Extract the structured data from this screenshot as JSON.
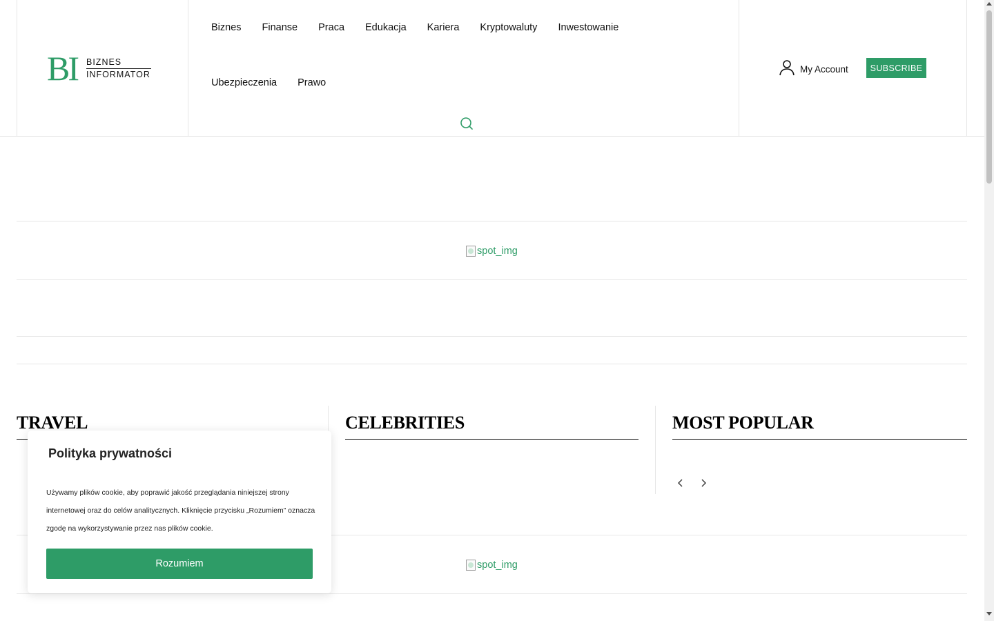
{
  "logo": {
    "mark": "BI",
    "line1": "BIZNES",
    "line2": "INFORMATOR"
  },
  "nav": {
    "row1": [
      "Biznes",
      "Finanse",
      "Praca",
      "Edukacja",
      "Kariera",
      "Kryptowaluty",
      "Inwestowanie"
    ],
    "row2": [
      "Ubezpieczenia",
      "Prawo"
    ],
    "search_icon": "search-icon"
  },
  "account": {
    "label": "My Account",
    "icon": "user-icon",
    "subscribe_label": "SUBSCRIBE"
  },
  "ads": {
    "top_alt": "spot_img",
    "bottom_alt": "spot_img"
  },
  "sections": {
    "travel": "TRAVEL",
    "celebrities": "CELEBRITIES",
    "most_popular": "MOST POPULAR"
  },
  "slider": {
    "prev_icon": "chevron-left-icon",
    "next_icon": "chevron-right-icon"
  },
  "cookie": {
    "title": "Polityka prywatności",
    "text": " Używamy plików cookie, aby poprawić jakość przeglądania niniejszej strony internetowej oraz do celów analitycznych. Kliknięcie przycisku „Rozumiem” oznacza zgodę na wykorzystywanie przez nas plików cookie.",
    "button": "Rozumiem"
  },
  "colors": {
    "accent": "#2e9c67",
    "divider": "#e6e6e6",
    "text": "#111111"
  }
}
